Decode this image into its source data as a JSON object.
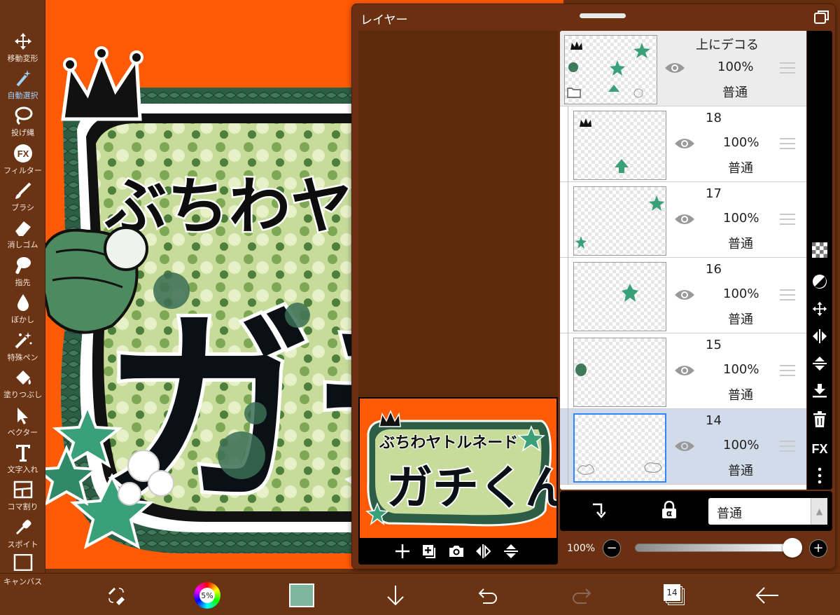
{
  "toolbar": {
    "tools": [
      {
        "label": "移動変形",
        "icon": "move-icon",
        "active": false
      },
      {
        "label": "自動選択",
        "icon": "magic-wand-icon",
        "active": true
      },
      {
        "label": "投げ縄",
        "icon": "lasso-icon",
        "active": false
      },
      {
        "label": "フィルター",
        "icon": "fx-icon",
        "active": false
      },
      {
        "label": "ブラシ",
        "icon": "brush-icon",
        "active": false
      },
      {
        "label": "消しゴム",
        "icon": "eraser-icon",
        "active": false
      },
      {
        "label": "指先",
        "icon": "finger-icon",
        "active": false
      },
      {
        "label": "ぼかし",
        "icon": "blur-drop-icon",
        "active": false
      },
      {
        "label": "特殊ペン",
        "icon": "special-pen-icon",
        "active": false
      },
      {
        "label": "塗りつぶし",
        "icon": "bucket-icon",
        "active": false
      },
      {
        "label": "ベクター",
        "icon": "vector-cursor-icon",
        "active": false
      },
      {
        "label": "文字入れ",
        "icon": "text-icon",
        "active": false
      },
      {
        "label": "コマ割り",
        "icon": "frame-divider-icon",
        "active": false
      },
      {
        "label": "スポイト",
        "icon": "eyedropper-icon",
        "active": false
      },
      {
        "label": "キャンバス",
        "icon": "canvas-icon",
        "active": false
      }
    ]
  },
  "layer_panel": {
    "title": "レイヤー",
    "layers": [
      {
        "name": "上にデコる",
        "opacity": "100%",
        "blend": "普通",
        "is_folder": true,
        "selected": false
      },
      {
        "name": "18",
        "opacity": "100%",
        "blend": "普通",
        "is_folder": false,
        "selected": false
      },
      {
        "name": "17",
        "opacity": "100%",
        "blend": "普通",
        "is_folder": false,
        "selected": false
      },
      {
        "name": "16",
        "opacity": "100%",
        "blend": "普通",
        "is_folder": false,
        "selected": false
      },
      {
        "name": "15",
        "opacity": "100%",
        "blend": "普通",
        "is_folder": false,
        "selected": false
      },
      {
        "name": "14",
        "opacity": "100%",
        "blend": "普通",
        "is_folder": false,
        "selected": true
      }
    ],
    "blend_mode": "普通",
    "opacity_label": "100%",
    "opacity_value": 1.0,
    "alpha_lock_symbol": "α",
    "fx_label": "FX"
  },
  "artwork": {
    "line1": "ぶちわヤトルネ",
    "line2": "ガチくん",
    "preview_line1": "ぶちわヤトルネード",
    "preview_line2": "ガチくん"
  },
  "bottombar": {
    "color_wheel_label": "5%",
    "current_color": "#7fb79c",
    "layer_count": "14"
  },
  "colors": {
    "canvas_bg": "#ff5a05",
    "ui_brown": "#6a3313",
    "selection_blue": "#2f86ff"
  }
}
